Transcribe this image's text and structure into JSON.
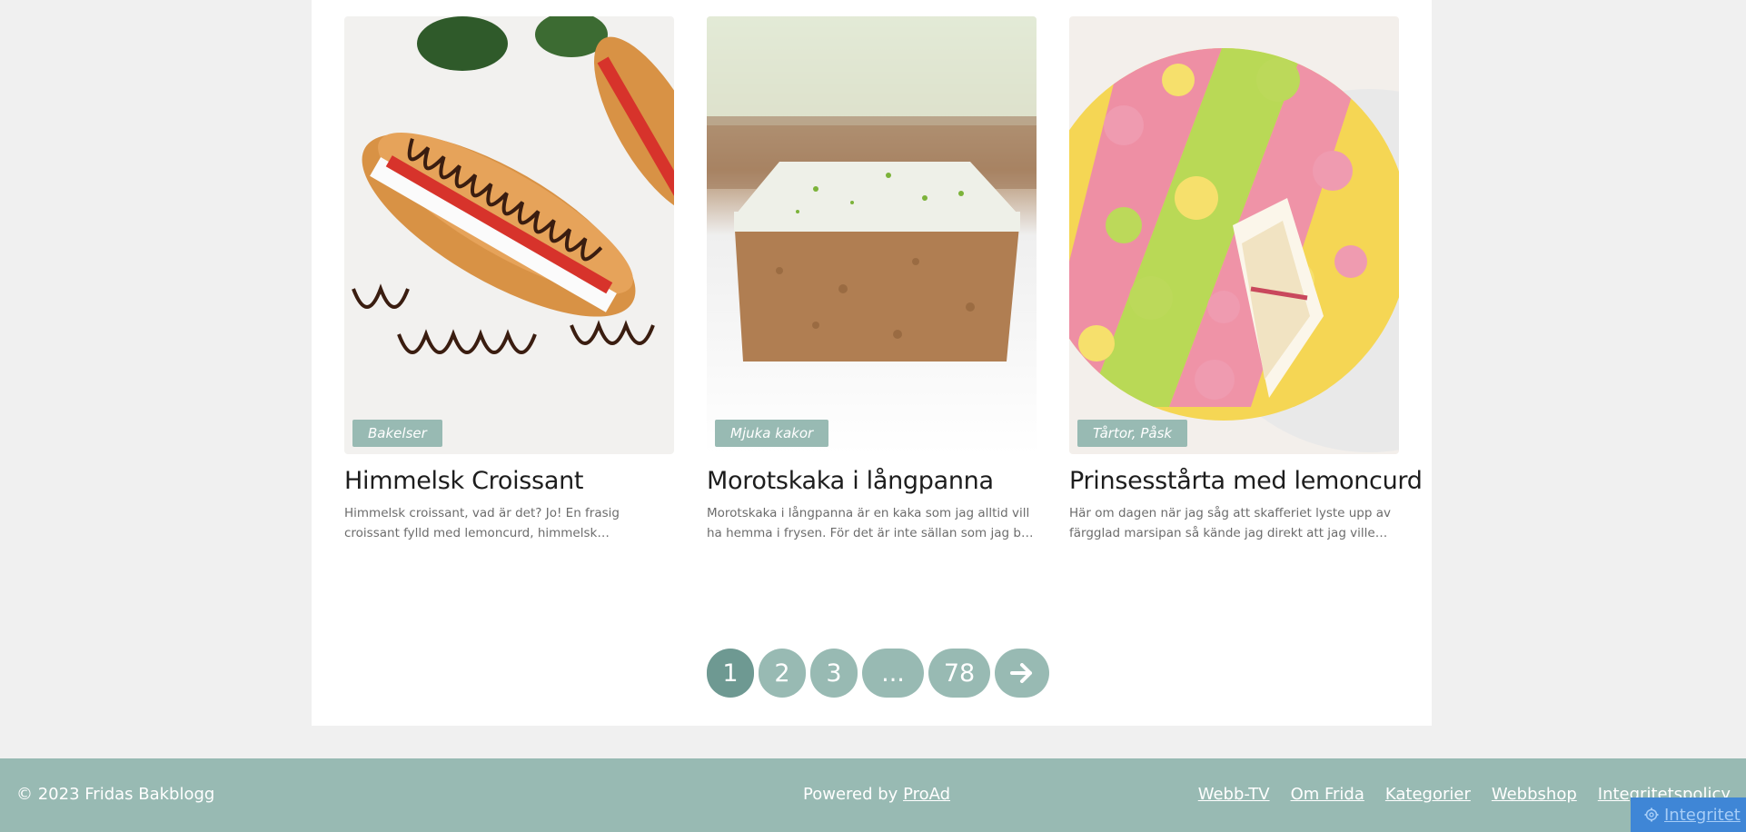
{
  "cards": [
    {
      "tag": "Bakelser",
      "title": "Himmelsk Croissant",
      "excerpt": "Himmelsk croissant, vad är det? Jo! En frasig croissant fylld med lemoncurd, himmelsk jordgubbsfyllnig och..."
    },
    {
      "tag": "Mjuka kakor",
      "title": "Morotskaka i långpanna",
      "excerpt": "Morotskaka i långpanna är en kaka som jag alltid vill ha hemma i frysen. För det är inte sällan som jag blir suge..."
    },
    {
      "tag": "Tårtor, Påsk",
      "title": "Prinsesstårta med lemoncurd",
      "excerpt": "Här om dagen när jag såg att skafferiet lyste upp av färgglad marsipan så kände jag direkt att jag ville baka..."
    }
  ],
  "pagination": {
    "pages": [
      "1",
      "2",
      "3",
      "...",
      "78"
    ],
    "current": "1",
    "next_icon": "arrow-right-icon"
  },
  "footer": {
    "copyright": "© 2023 Fridas Bakblogg",
    "powered_prefix": "Powered by ",
    "powered_link": "ProAd",
    "links": [
      "Webb-TV",
      "Om Frida",
      "Kategorier",
      "Webbshop",
      "Integritetspolicy"
    ]
  },
  "privacy_button": {
    "icon": "gear-icon",
    "label": "Integritet"
  },
  "colors": {
    "accent": "#98bab3",
    "accent_active": "#6e9992",
    "privacy_blue": "#3f86d6"
  }
}
